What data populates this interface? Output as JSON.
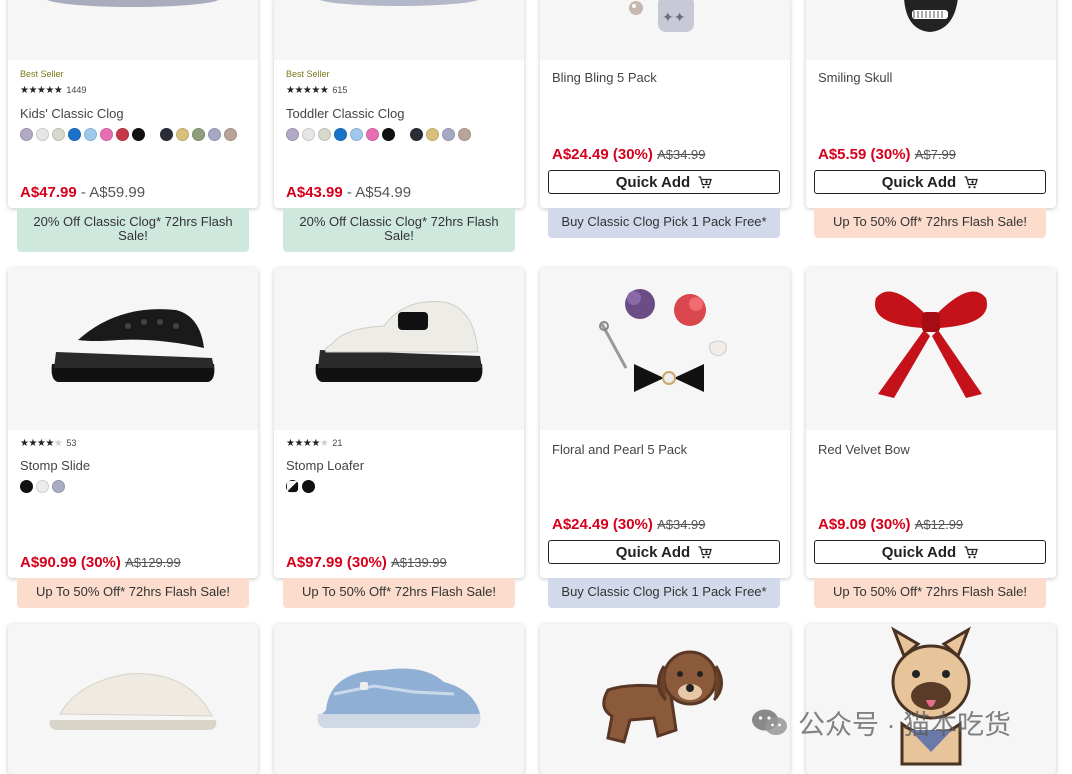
{
  "colors": {
    "sale_red": "#d6001c",
    "banner_green": "#cfe8de",
    "banner_blue": "#d2d9ea",
    "banner_peach": "#fbdccd"
  },
  "quick_add_label": "Quick Add",
  "products": {
    "kids_classic_clog": {
      "badge": "Best Seller",
      "reviews": "1449",
      "name": "Kids' Classic Clog",
      "price": "A$47.99",
      "sep": " - ",
      "was": "A$59.99",
      "banner": "20% Off Classic Clog* 72hrs Flash Sale!"
    },
    "toddler_classic_clog": {
      "badge": "Best Seller",
      "reviews": "615",
      "name": "Toddler Classic Clog",
      "price": "A$43.99",
      "sep": " - ",
      "was": "A$54.99",
      "banner": "20% Off Classic Clog* 72hrs Flash Sale!"
    },
    "bling_bling": {
      "name": "Bling Bling 5 Pack",
      "price": "A$24.49 (30%)",
      "was": "A$34.99",
      "banner": "Buy Classic Clog Pick 1 Pack Free*"
    },
    "smiling_skull": {
      "name": "Smiling Skull",
      "price": "A$5.59 (30%)",
      "was": "A$7.99",
      "banner": "Up To 50% Off* 72hrs Flash Sale!"
    },
    "stomp_slide": {
      "reviews": "53",
      "name": "Stomp Slide",
      "price": "A$90.99 (30%)",
      "was": "A$129.99",
      "banner": "Up To 50% Off* 72hrs Flash Sale!"
    },
    "stomp_loafer": {
      "reviews": "21",
      "name": "Stomp Loafer",
      "price": "A$97.99 (30%)",
      "was": "A$139.99",
      "banner": "Up To 50% Off* 72hrs Flash Sale!"
    },
    "floral_pearl": {
      "name": "Floral and Pearl 5 Pack",
      "price": "A$24.49 (30%)",
      "was": "A$34.99",
      "banner": "Buy Classic Clog Pick 1 Pack Free*"
    },
    "red_velvet_bow": {
      "name": "Red Velvet Bow",
      "price": "A$9.09 (30%)",
      "was": "A$12.99",
      "banner": "Up To 50% Off* 72hrs Flash Sale!"
    }
  },
  "watermark": {
    "text_a": "公众号 · ",
    "text_b": "猫本吃货"
  }
}
